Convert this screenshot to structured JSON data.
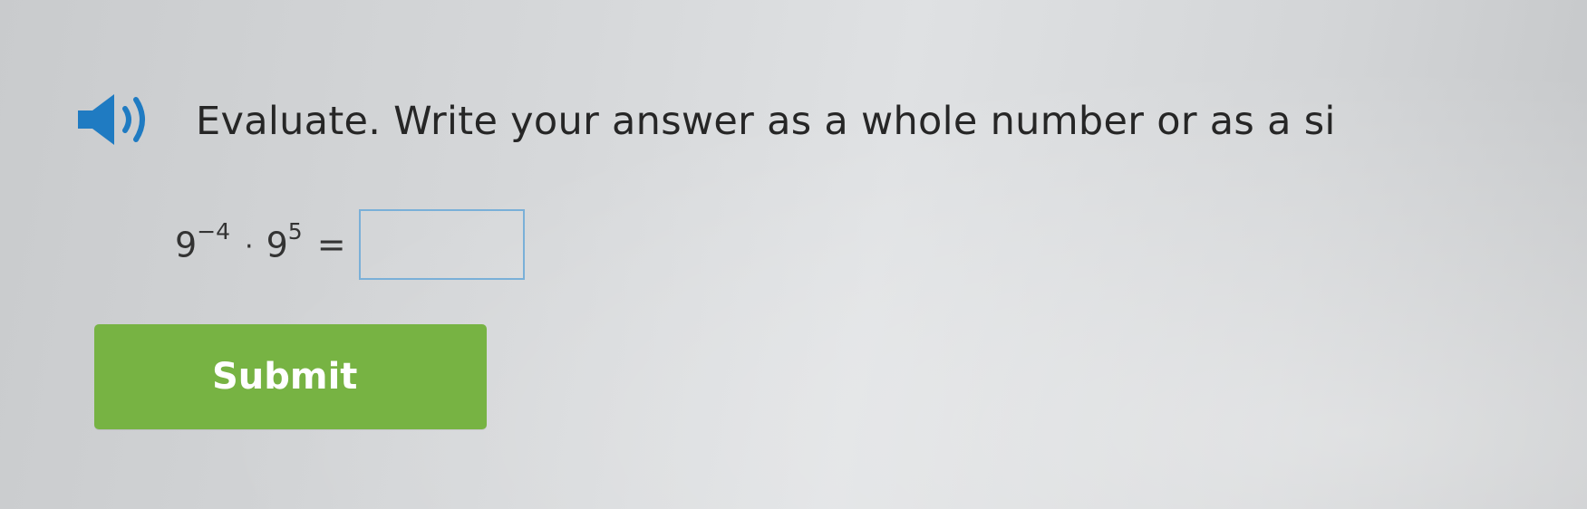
{
  "question": {
    "prompt": "Evaluate. Write your answer as a whole number or as a si"
  },
  "equation": {
    "base1": "9",
    "exp1": "−4",
    "dot": "·",
    "base2": "9",
    "exp2": "5",
    "equals": "="
  },
  "answer": {
    "value": ""
  },
  "submit": {
    "label": "Submit"
  },
  "colors": {
    "submit_green": "#77b343",
    "input_border": "#7ab0d8",
    "speaker_blue": "#1f7bc2"
  },
  "icons": {
    "speaker": "speaker-icon"
  }
}
